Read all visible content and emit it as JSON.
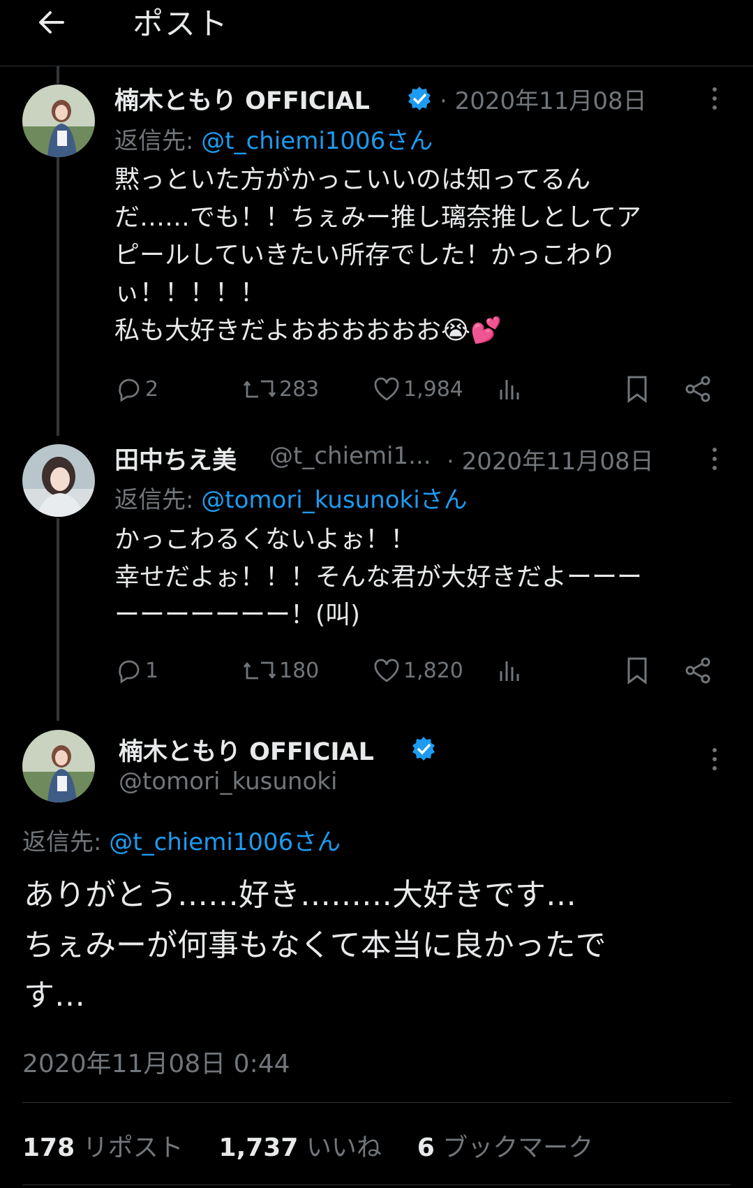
{
  "header": {
    "title": "ポスト"
  },
  "tweets": [
    {
      "name": "楠木ともり OFFICIAL",
      "handle": "",
      "date": "· 2020年11月08日",
      "reply_label": "返信先: ",
      "reply_handle": "@t_chiemi1006さん",
      "text": "黙っといた方がかっこいいのは知ってるん\nだ……でも！！ちぇみー推し璃奈推しとしてア\nピールしていきたい所存でした！かっこわり\nぃ！！！！！\n私も大好きだよおおおおおお😭💕",
      "stats": {
        "replies": "2",
        "reposts": "283",
        "likes": "1,984"
      }
    },
    {
      "name": "田中ちえ美",
      "handle": "@t_chiemi1...",
      "date": "· 2020年11月08日",
      "reply_label": "返信先: ",
      "reply_handle": "@tomori_kusunokiさん",
      "text": "かっこわるくないよぉ！！\n幸せだよぉ！！！そんな君が大好きだよーーー\nーーーーーーー！(叫)",
      "stats": {
        "replies": "1",
        "reposts": "180",
        "likes": "1,820"
      }
    }
  ],
  "main": {
    "name": "楠木ともり OFFICIAL",
    "handle": "@tomori_kusunoki",
    "reply_label": "返信先: ",
    "reply_handle": "@t_chiemi1006さん",
    "text": "ありがとう……好き………大好きです…\nちぇみーが何事もなくて本当に良かったで\nす…",
    "timestamp": "2020年11月08日 0:44",
    "stats": {
      "reposts_count": "178",
      "reposts_label": "リポスト",
      "likes_count": "1,737",
      "likes_label": "いいね",
      "bookmarks_count": "6",
      "bookmarks_label": "ブックマーク"
    }
  },
  "colors": {
    "accent": "#1d9bf0",
    "muted": "#71767b",
    "text": "#e7e9ea",
    "background": "#000000"
  },
  "icons": [
    "back-arrow-icon",
    "verified-badge-icon",
    "more-icon",
    "reply-icon",
    "repost-icon",
    "like-icon",
    "views-icon",
    "bookmark-icon",
    "share-icon"
  ]
}
